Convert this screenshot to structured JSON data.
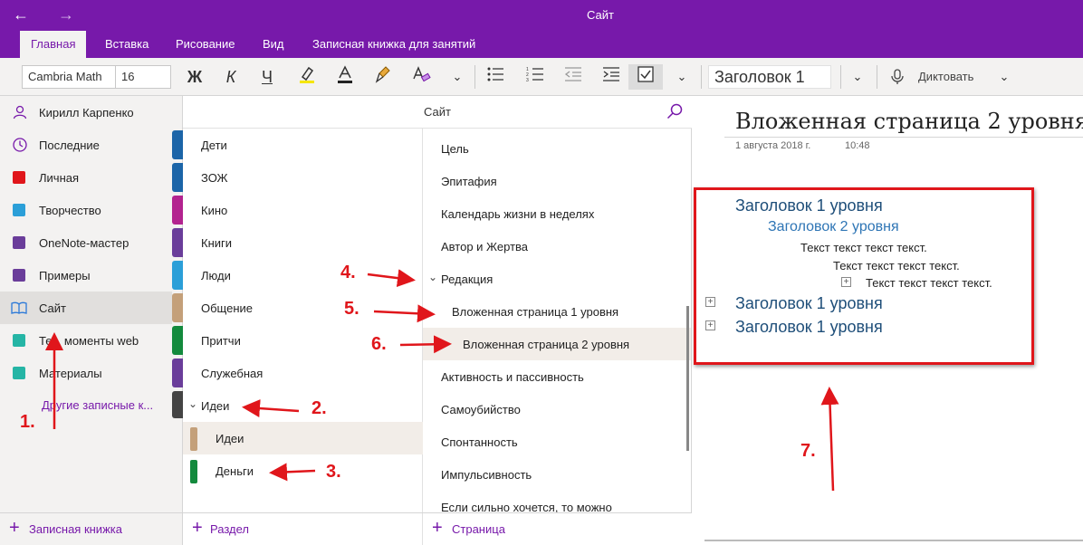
{
  "window": {
    "title": "Сайт"
  },
  "tabs": [
    {
      "label": "Главная",
      "active": true
    },
    {
      "label": "Вставка"
    },
    {
      "label": "Рисование"
    },
    {
      "label": "Вид"
    },
    {
      "label": "Записная книжка для занятий"
    }
  ],
  "ribbon": {
    "font_name": "Cambria Math",
    "font_size": "16",
    "bold": "Ж",
    "italic": "К",
    "underline": "Ч",
    "style": "Заголовок 1",
    "dictate": "Диктовать"
  },
  "user": {
    "name": "Кирилл Карпенко"
  },
  "notebooks": [
    {
      "label": "Последние",
      "icon": "clock-icon",
      "color": "#7719aa",
      "tab_color": "#1c65a8"
    },
    {
      "label": "Личная",
      "icon": "notebook-icon",
      "color": "#e0161b",
      "tab_color": "#1c65a8"
    },
    {
      "label": "Творчество",
      "icon": "notebook-icon",
      "color": "#2b9fd8",
      "tab_color": "#b3238f"
    },
    {
      "label": "OneNote-мастер",
      "icon": "notebook-icon",
      "color": "#6a3d9a",
      "tab_color": "#6a3d9a"
    },
    {
      "label": "Примеры",
      "icon": "notebook-icon",
      "color": "#6a3d9a",
      "tab_color": "#2b9fd8"
    },
    {
      "label": "Сайт",
      "icon": "open-book-icon",
      "color": "#2b79d8",
      "tab_color": "#c4a07a"
    },
    {
      "label": "Тех. моменты web",
      "icon": "notebook-icon",
      "color": "#25b5a5",
      "tab_color": "#138a3d"
    },
    {
      "label": "Материалы",
      "icon": "notebook-icon",
      "color": "#25b5a5",
      "tab_color": "#6a3d9a"
    }
  ],
  "more_notebooks": "Другие записные к...",
  "add_notebook": "Записная книжка",
  "search": {
    "title": "Сайт"
  },
  "sections": [
    {
      "label": "Дети"
    },
    {
      "label": "ЗОЖ"
    },
    {
      "label": "Кино"
    },
    {
      "label": "Книги"
    },
    {
      "label": "Люди"
    },
    {
      "label": "Общение"
    },
    {
      "label": "Притчи"
    },
    {
      "label": "Служебная"
    },
    {
      "label": "Идеи",
      "group": true
    },
    {
      "label": "Идеи",
      "color": "#c4a07a",
      "selected": true
    },
    {
      "label": "Деньги",
      "color": "#138a3d"
    }
  ],
  "add_section": "Раздел",
  "pages": [
    {
      "label": "Цель"
    },
    {
      "label": "Эпитафия"
    },
    {
      "label": "Календарь жизни в неделях"
    },
    {
      "label": "Автор и Жертва"
    },
    {
      "label": "Редакция",
      "expanded": true
    },
    {
      "label": "Вложенная страница 1 уровня",
      "level": 1
    },
    {
      "label": "Вложенная страница 2 уровня",
      "level": 2,
      "selected": true
    },
    {
      "label": "Активность и пассивность"
    },
    {
      "label": "Самоубийство"
    },
    {
      "label": "Спонтанность"
    },
    {
      "label": "Импульсивность"
    },
    {
      "label": "Если сильно хочется, то можно"
    }
  ],
  "add_page": "Страница",
  "page": {
    "title": "Вложенная страница 2 уровня",
    "date": "1 августа 2018 г.",
    "time": "10:48",
    "heading1_a": "Заголовок 1 уровня",
    "heading2": "Заголовок 2 уровня",
    "text1": "Текст текст текст текст.",
    "text2": "Текст текст текст текст.",
    "text3": "Текст текст текст текст.",
    "heading1_b": "Заголовок 1 уровня",
    "heading1_c": "Заголовок 1 уровня"
  },
  "annotations": [
    "1.",
    "2.",
    "3.",
    "4.",
    "5.",
    "6.",
    "7."
  ],
  "colors": {
    "accent": "#7719aa",
    "annotation": "#e0161b"
  }
}
